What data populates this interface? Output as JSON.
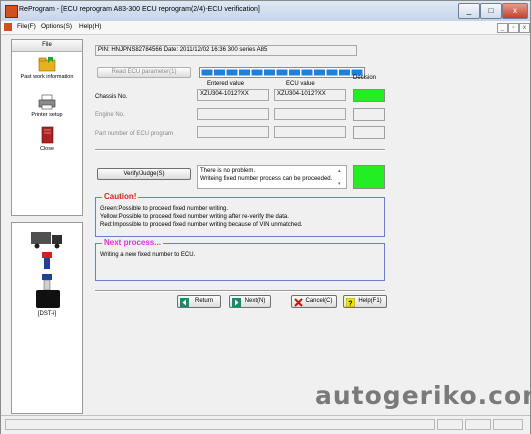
{
  "window": {
    "title": "ReProgram - [ECU reprogram A83-300 ECU reprogram(2/4)-ECU verification]",
    "min_label": "_",
    "max_label": "□",
    "close_label": "x"
  },
  "menu": {
    "items": [
      "File(F)",
      "Options(S)",
      "Help(H)"
    ]
  },
  "sidebar": {
    "header": "File",
    "items": [
      {
        "label": "Past work information",
        "icon": "folder-icon"
      },
      {
        "label": "Printer setup",
        "icon": "printer-icon"
      },
      {
        "label": "Close",
        "icon": "book-icon"
      }
    ]
  },
  "vehicle_panel": {
    "items": [
      {
        "label": "[DST-i]",
        "icon": "dst-device-icon"
      }
    ]
  },
  "header_box": {
    "text": "PIN: HNJPNS82784566  Date: 2011/12/02 16:36  300 series A85"
  },
  "read_button": {
    "label": "Read ECU parameter(1)"
  },
  "progress": {
    "filled_segments": 13,
    "total_segments": 13
  },
  "table": {
    "col_entered": "Entered value",
    "col_ecu": "ECU value",
    "col_decision": "Decision",
    "rows": [
      {
        "label": "Chassis No.",
        "entered": "XZU304-1012?XX",
        "ecu": "XZU304-1012?XX",
        "decision": "green"
      },
      {
        "label": "Engine No.",
        "entered": "",
        "ecu": "",
        "decision": "none"
      },
      {
        "label": "Part number of ECU program",
        "entered": "",
        "ecu": "",
        "decision": "none"
      }
    ]
  },
  "verify": {
    "button_label": "Verify/Judge(S)",
    "message_line1": "There is no problem.",
    "message_line2": "Writeing fixed number process can be proceeded.",
    "decision": "green"
  },
  "caution": {
    "title": "Caution!",
    "lines": [
      "Green:Possible to proceed fixed number writing.",
      "Yellow:Possible to proceed fixed number writing after re-verify the data.",
      "Red:Impossible to proceed fixed number writing because of VIN unmatched."
    ]
  },
  "next_process": {
    "title": "Next process...",
    "text": "Writing a new fixed number to ECU."
  },
  "buttons": {
    "return": "Return",
    "next": "Next(N)",
    "cancel": "Cancel(C)",
    "help": "Help(F1)"
  },
  "watermark": "autogeriko.com",
  "colors": {
    "decision_green": "#22ee22",
    "progress_blue": "#1f7fdc",
    "caution_red": "#e02020",
    "next_magenta": "#e030e0",
    "group_blue": "#6a7fd0"
  }
}
